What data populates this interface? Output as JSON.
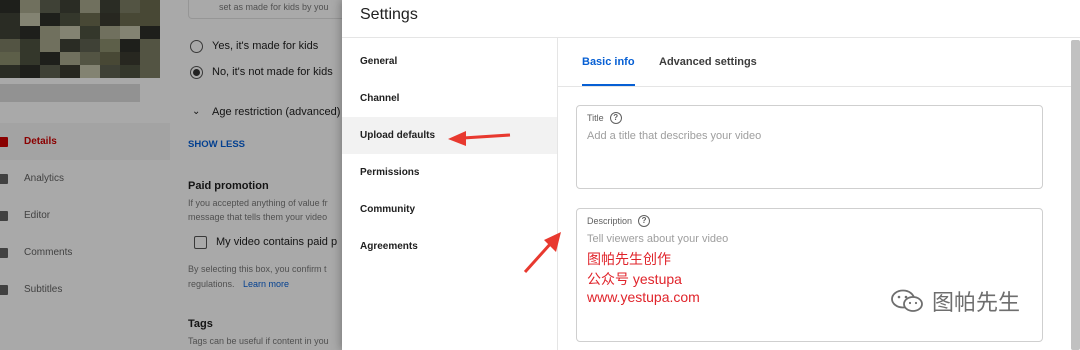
{
  "background": {
    "hint": "set as made for kids by you",
    "radio_yes": "Yes, it's made for kids",
    "radio_no": "No, it's not made for kids",
    "age_restriction": "Age restriction (advanced)",
    "show_less": "SHOW LESS",
    "paid_title": "Paid promotion",
    "paid_desc_1": "If you accepted anything of value fr",
    "paid_desc_2": "message that tells them your video",
    "paid_checkbox": "My video contains paid p",
    "paid_note_1": "By selecting this box, you confirm t",
    "paid_note_2": "regulations.",
    "learn_more": "Learn more",
    "tags_title": "Tags",
    "tags_desc": "Tags can be useful if content in you",
    "nav": [
      {
        "label": "Details",
        "icon": "pencil-icon"
      },
      {
        "label": "Analytics",
        "icon": "analytics-icon"
      },
      {
        "label": "Editor",
        "icon": "editor-icon"
      },
      {
        "label": "Comments",
        "icon": "comments-icon"
      },
      {
        "label": "Subtitles",
        "icon": "subtitles-icon"
      }
    ]
  },
  "dialog": {
    "title": "Settings",
    "nav": [
      "General",
      "Channel",
      "Upload defaults",
      "Permissions",
      "Community",
      "Agreements"
    ],
    "active_nav": "Upload defaults",
    "tabs": [
      "Basic info",
      "Advanced settings"
    ],
    "active_tab": "Basic info",
    "title_field": {
      "label": "Title",
      "placeholder": "Add a title that describes your video"
    },
    "description_field": {
      "label": "Description",
      "placeholder": "Tell viewers about your video"
    }
  },
  "annotation": {
    "lines": [
      "图帕先生创作",
      "公众号 yestupa",
      "www.yestupa.com"
    ],
    "color": "#e0242b"
  },
  "watermark": {
    "text": "图帕先生"
  },
  "colors": {
    "accent": "#065fd4",
    "active_red": "#cc0000",
    "annotation_red": "#e0242b"
  }
}
